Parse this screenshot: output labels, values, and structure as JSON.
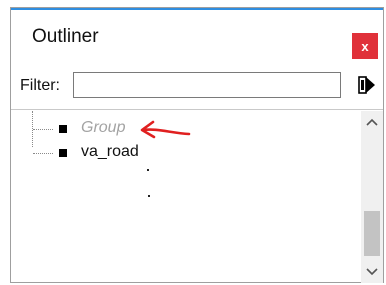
{
  "window": {
    "title": "Outliner",
    "close_label": "x"
  },
  "filter": {
    "label": "Filter:",
    "value": "",
    "placeholder": ""
  },
  "tree": {
    "items": [
      {
        "label": "Group",
        "state": "hidden"
      },
      {
        "label": "va_road",
        "state": "visible"
      }
    ]
  },
  "icons": {
    "close": "close-icon",
    "filter_apply": "filter-arrow-icon",
    "scroll_up": "chevron-up-icon",
    "scroll_down": "chevron-down-icon",
    "annotation": "red-arrow-annotation"
  },
  "colors": {
    "accent": "#2f8ee0",
    "close_bg": "#e0313a",
    "annotation": "#e02020",
    "hidden_text": "#a3a3a3"
  }
}
